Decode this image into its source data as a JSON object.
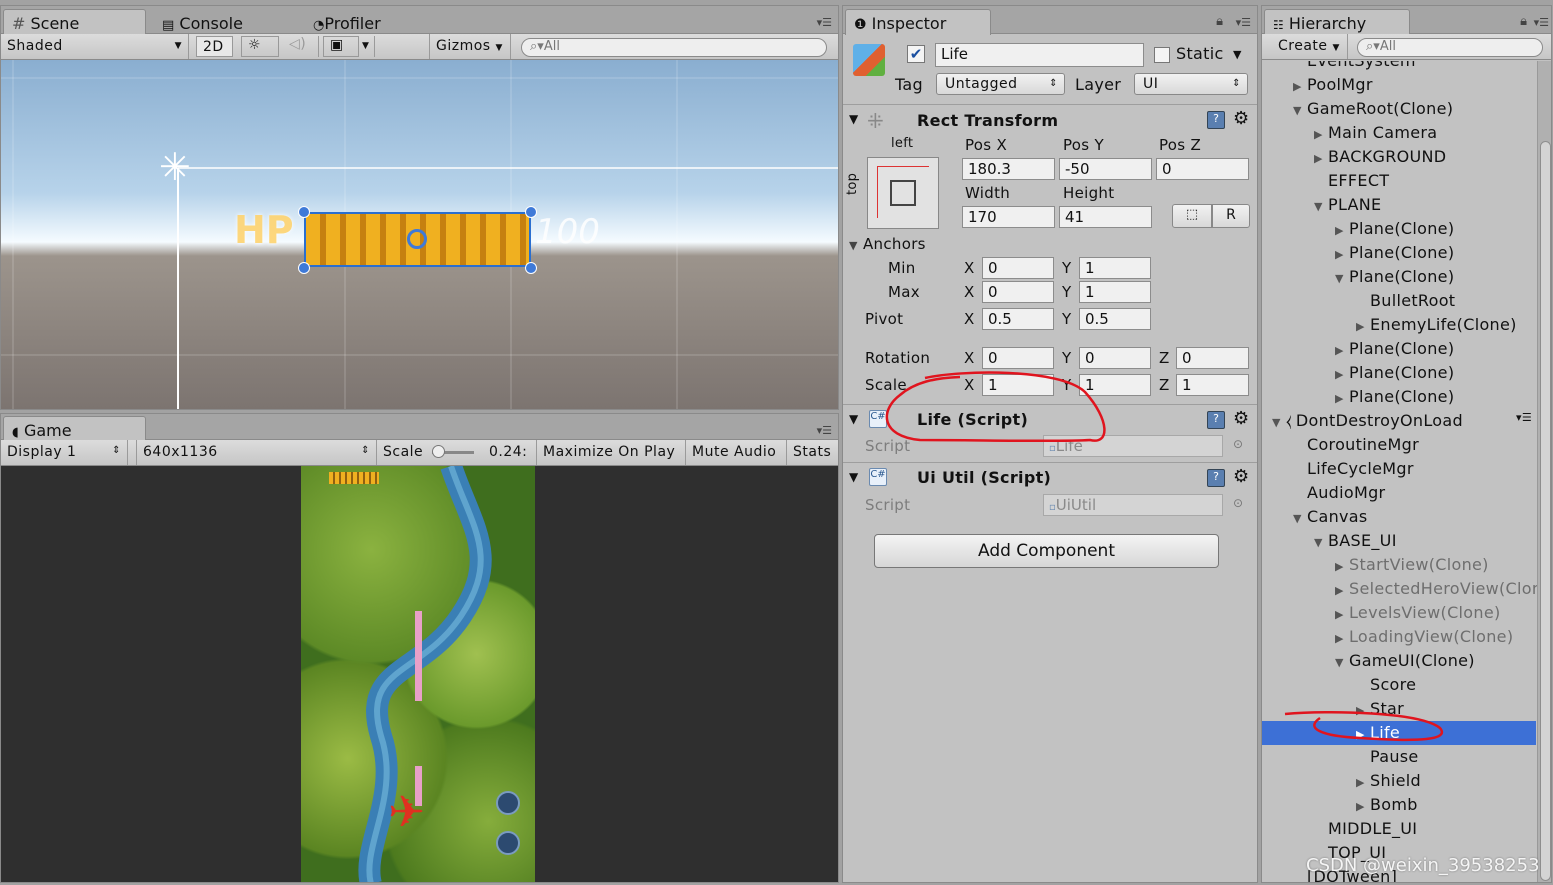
{
  "scene": {
    "tabs": [
      "Scene",
      "Console",
      "Profiler"
    ],
    "toolbar": {
      "shading": "Shaded",
      "mode_2d": "2D",
      "gizmos": "Gizmos",
      "search_placeholder": "All"
    },
    "hp_label": "HP",
    "hp_value": "100"
  },
  "game": {
    "tab": "Game",
    "display": "Display 1",
    "resolution": "640x1136",
    "scale_label": "Scale",
    "scale_value": "0.24:",
    "scale_fraction": 0.24,
    "maximize": "Maximize On Play",
    "mute": "Mute Audio",
    "stats": "Stats"
  },
  "inspector": {
    "tab": "Inspector",
    "object_name": "Life",
    "active": true,
    "static_label": "Static",
    "static": false,
    "tag_label": "Tag",
    "tag_value": "Untagged",
    "layer_label": "Layer",
    "layer_value": "UI",
    "rect_transform": {
      "title": "Rect Transform",
      "anchor_h": "left",
      "anchor_v": "top",
      "posx_label": "Pos X",
      "posx": "180.3",
      "posy_label": "Pos Y",
      "posy": "-50",
      "posz_label": "Pos Z",
      "posz": "0",
      "width_label": "Width",
      "width": "170",
      "height_label": "Height",
      "height": "41",
      "r_button": "R",
      "anchors_label": "Anchors",
      "min_label": "Min",
      "min_x": "0",
      "min_y": "1",
      "max_label": "Max",
      "max_x": "0",
      "max_y": "1",
      "pivot_label": "Pivot",
      "pivot_x": "0.5",
      "pivot_y": "0.5",
      "rotation_label": "Rotation",
      "rot_x": "0",
      "rot_y": "0",
      "rot_z": "0",
      "scale_label": "Scale",
      "scale_x": "1",
      "scale_y": "1",
      "scale_z": "1",
      "x": "X",
      "y": "Y",
      "z": "Z"
    },
    "life_script": {
      "title": "Life (Script)",
      "script_label": "Script",
      "script_value": "Life"
    },
    "uiutil_script": {
      "title": "Ui Util (Script)",
      "script_label": "Script",
      "script_value": "UiUtil"
    },
    "add_component": "Add Component"
  },
  "hierarchy": {
    "tab": "Hierarchy",
    "create": "Create",
    "search_placeholder": "All",
    "items": [
      {
        "label": "EventSystem",
        "indent": 1,
        "arrow": "none"
      },
      {
        "label": "PoolMgr",
        "indent": 1,
        "arrow": "right"
      },
      {
        "label": "GameRoot(Clone)",
        "indent": 1,
        "arrow": "down"
      },
      {
        "label": "Main Camera",
        "indent": 2,
        "arrow": "right"
      },
      {
        "label": "BACKGROUND",
        "indent": 2,
        "arrow": "right"
      },
      {
        "label": "EFFECT",
        "indent": 2,
        "arrow": "none"
      },
      {
        "label": "PLANE",
        "indent": 2,
        "arrow": "down"
      },
      {
        "label": "Plane(Clone)",
        "indent": 3,
        "arrow": "right"
      },
      {
        "label": "Plane(Clone)",
        "indent": 3,
        "arrow": "right"
      },
      {
        "label": "Plane(Clone)",
        "indent": 3,
        "arrow": "down"
      },
      {
        "label": "BulletRoot",
        "indent": 4,
        "arrow": "none"
      },
      {
        "label": "EnemyLife(Clone)",
        "indent": 4,
        "arrow": "right"
      },
      {
        "label": "Plane(Clone)",
        "indent": 3,
        "arrow": "right"
      },
      {
        "label": "Plane(Clone)",
        "indent": 3,
        "arrow": "right"
      },
      {
        "label": "Plane(Clone)",
        "indent": 3,
        "arrow": "right"
      },
      {
        "label": "DontDestroyOnLoad",
        "indent": 0,
        "arrow": "down",
        "scene": true
      },
      {
        "label": "CoroutineMgr",
        "indent": 1,
        "arrow": "none"
      },
      {
        "label": "LifeCycleMgr",
        "indent": 1,
        "arrow": "none"
      },
      {
        "label": "AudioMgr",
        "indent": 1,
        "arrow": "none"
      },
      {
        "label": "Canvas",
        "indent": 1,
        "arrow": "down"
      },
      {
        "label": "BASE_UI",
        "indent": 2,
        "arrow": "down"
      },
      {
        "label": "StartView(Clone)",
        "indent": 3,
        "arrow": "right",
        "dim": true
      },
      {
        "label": "SelectedHeroView(Clone)",
        "indent": 3,
        "arrow": "right",
        "dim": true
      },
      {
        "label": "LevelsView(Clone)",
        "indent": 3,
        "arrow": "right",
        "dim": true
      },
      {
        "label": "LoadingView(Clone)",
        "indent": 3,
        "arrow": "right",
        "dim": true
      },
      {
        "label": "GameUI(Clone)",
        "indent": 3,
        "arrow": "down"
      },
      {
        "label": "Score",
        "indent": 4,
        "arrow": "none"
      },
      {
        "label": "Star",
        "indent": 4,
        "arrow": "right"
      },
      {
        "label": "Life",
        "indent": 4,
        "arrow": "right",
        "selected": true
      },
      {
        "label": "Pause",
        "indent": 4,
        "arrow": "none"
      },
      {
        "label": "Shield",
        "indent": 4,
        "arrow": "right"
      },
      {
        "label": "Bomb",
        "indent": 4,
        "arrow": "right"
      },
      {
        "label": "MIDDLE_UI",
        "indent": 2,
        "arrow": "none"
      },
      {
        "label": "TOP_UI",
        "indent": 2,
        "arrow": "none"
      },
      {
        "label": "[DOTween]",
        "indent": 1,
        "arrow": "none"
      }
    ]
  },
  "watermark": "CSDN @weixin_39538253",
  "colors": {
    "panel": "#c2c2c2",
    "selection": "#3d70d6",
    "annotation": "#e0141e",
    "hp_bar": "#f0b020"
  }
}
